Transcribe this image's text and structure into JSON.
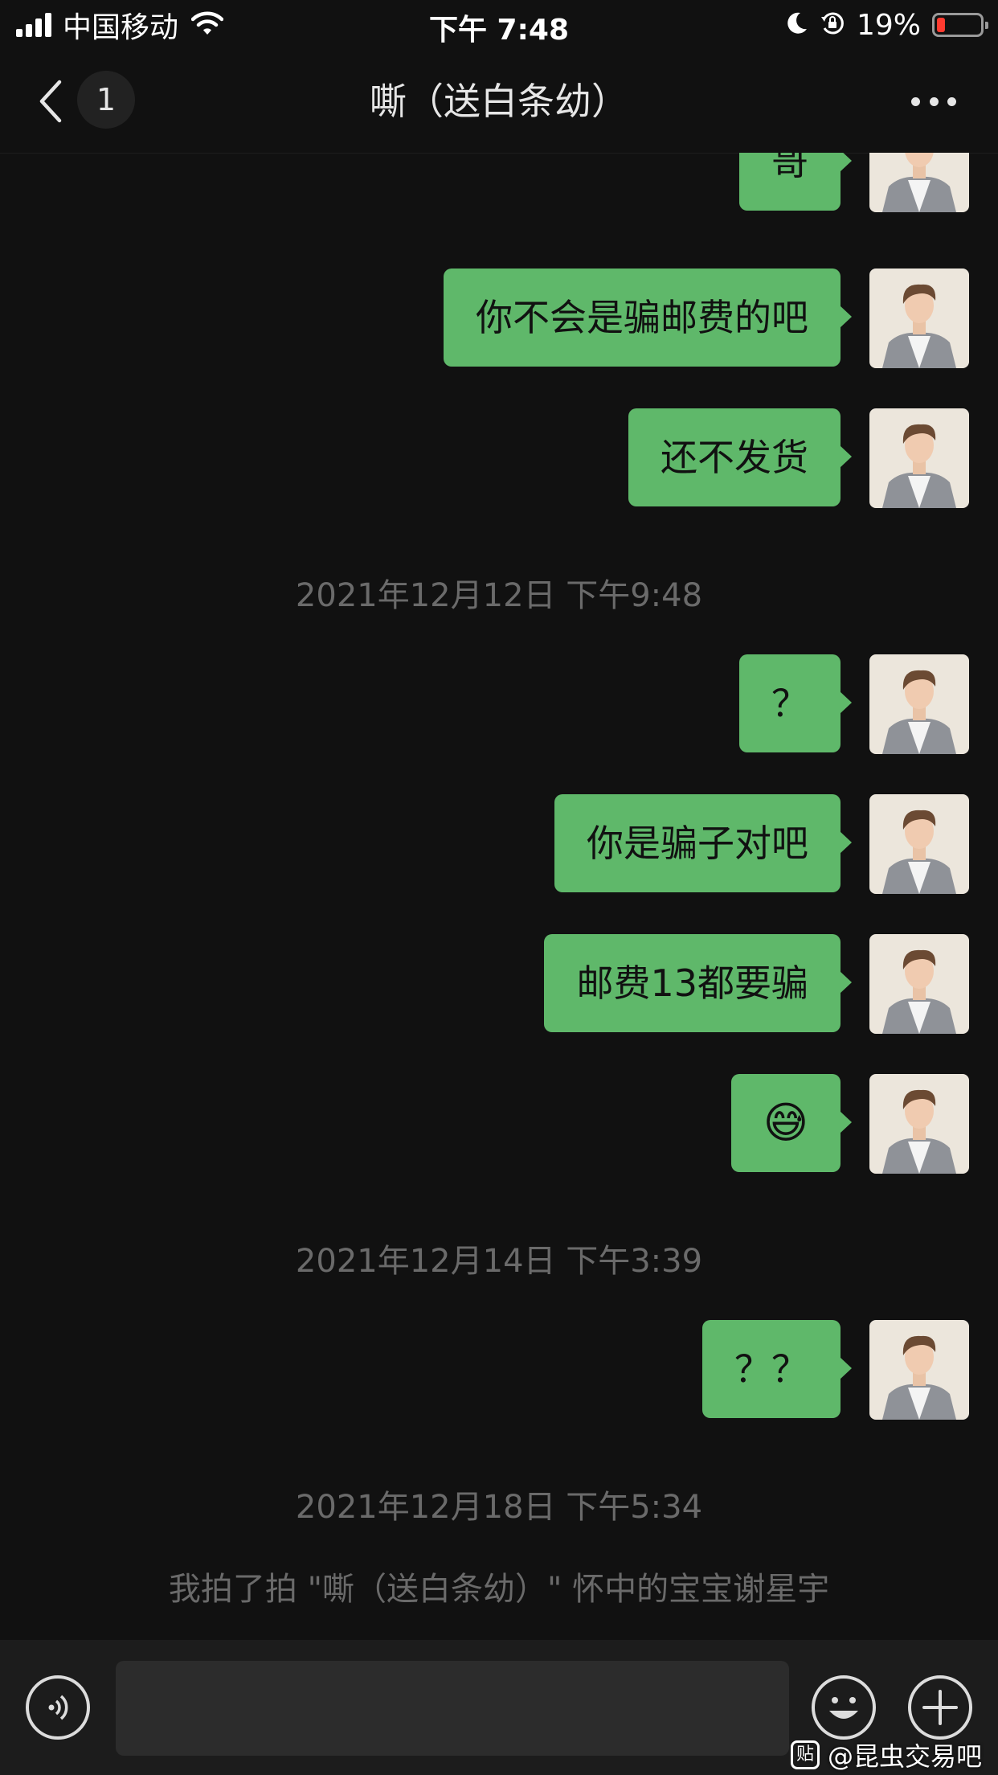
{
  "status_bar": {
    "carrier": "中国移动",
    "time": "下午 7:48",
    "battery_percent": "19%",
    "battery_level": 0.19
  },
  "nav": {
    "unread_count": "1",
    "title": "嘶（送白条幼）"
  },
  "messages": [
    {
      "text": "哥",
      "sender": "self"
    },
    {
      "text": "你不会是骗邮费的吧",
      "sender": "self"
    },
    {
      "text": "还不发货",
      "sender": "self"
    },
    {
      "text": "？",
      "sender": "self"
    },
    {
      "text": "你是骗子对吧",
      "sender": "self"
    },
    {
      "text": "邮费13都要骗",
      "sender": "self"
    },
    {
      "text": "😅",
      "sender": "self"
    },
    {
      "text": "？？",
      "sender": "self"
    }
  ],
  "timestamps": [
    "2021年12月12日 下午9:48",
    "2021年12月14日 下午3:39",
    "2021年12月18日 下午5:34"
  ],
  "system_note": "我拍了拍 \"嘶（送白条幼）\" 怀中的宝宝谢星宇",
  "watermark": {
    "logo_text": "贴",
    "text": "@昆虫交易吧"
  },
  "colors": {
    "background": "#111111",
    "bubble_self": "#5fb86a",
    "timestamp_text": "#6a6a6a"
  }
}
